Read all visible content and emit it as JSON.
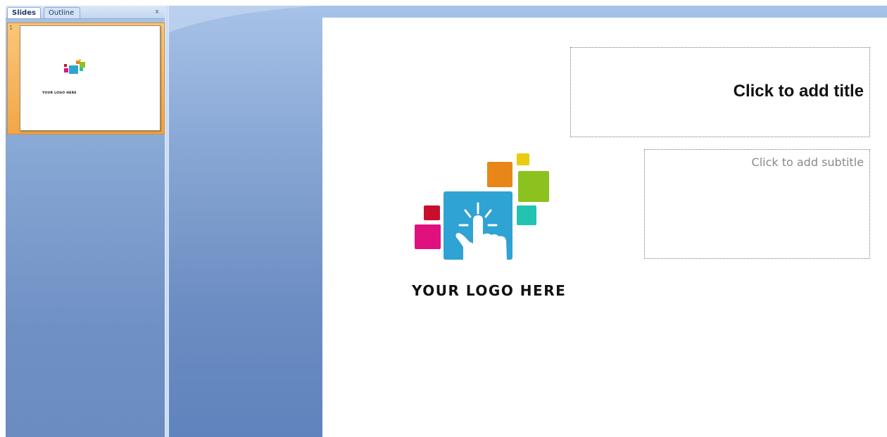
{
  "pane": {
    "tabs": [
      {
        "label": "Slides",
        "active": true
      },
      {
        "label": "Outline",
        "active": false
      }
    ],
    "close_glyph": "x"
  },
  "thumbnail": {
    "slide_number": "1",
    "logo_text": "YOUR LOGO HERE"
  },
  "slide": {
    "title_placeholder": "Click to add title",
    "subtitle_placeholder": "Click to add subtitle",
    "logo_text": "YOUR LOGO HERE"
  },
  "colors": {
    "logo_blue": "#2ea3d4",
    "logo_orange": "#e8861a",
    "logo_yellow": "#e8cc10",
    "logo_green": "#8cc21f",
    "logo_teal": "#24c2b0",
    "logo_red": "#c8102e",
    "logo_magenta": "#e0117f",
    "thumb_selected": "#f2a648"
  },
  "icons": {
    "logo": "touch-hand-logo-icon",
    "close": "close-icon"
  }
}
